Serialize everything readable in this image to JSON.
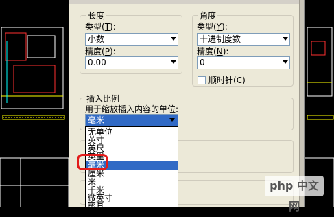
{
  "length": {
    "title": "长度",
    "type_label": "类型",
    "type_hotkey": "T",
    "type_value": "小数",
    "precision_label": "精度",
    "precision_hotkey": "P",
    "precision_value": "0.00"
  },
  "angle": {
    "title": "角度",
    "type_label": "类型",
    "type_hotkey": "Y",
    "type_value": "十进制度数",
    "precision_label": "精度",
    "precision_hotkey": "N",
    "precision_value": "0",
    "clockwise_label": "顺时针",
    "clockwise_hotkey": "C",
    "clockwise_checked": false
  },
  "insert_scale": {
    "title": "插入比例",
    "subtitle": "用于缩放插入内容的单位:",
    "value": "毫米",
    "options": [
      "无单位",
      "英寸",
      "英尺",
      "英里",
      "毫米",
      "厘米",
      "米",
      "千米",
      "微英寸",
      "密耳"
    ],
    "selected_index": 4
  },
  "watermark": "php 中文网",
  "colors": {
    "dialog_bg": "#ece9d8",
    "selection": "#316ac5",
    "highlight_ring": "#e21b1b"
  }
}
